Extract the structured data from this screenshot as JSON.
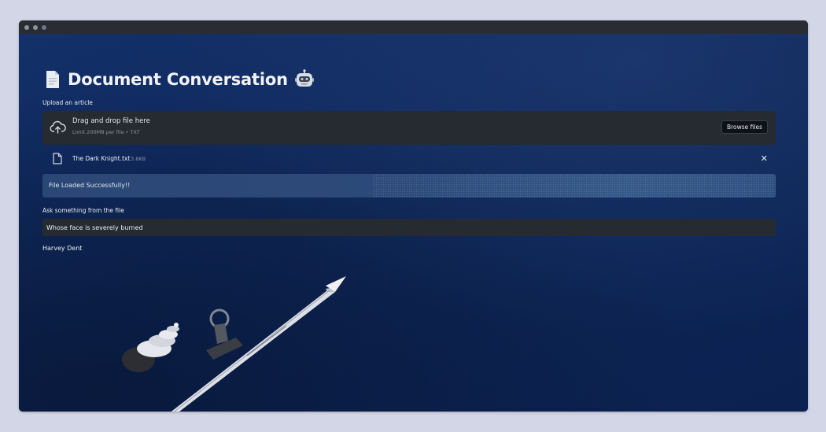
{
  "app": {
    "title": "Document Conversation",
    "title_icon_left": "document-icon",
    "title_icon_right": "robot-icon"
  },
  "uploader": {
    "label": "Upload an article",
    "drag_text": "Drag and drop file here",
    "limit_text": "Limit 200MB per file • TXT",
    "browse_label": "Browse files",
    "icon": "cloud-upload-icon"
  },
  "file": {
    "name": "The Dark Knight.txt",
    "size": "3.8KB",
    "icon": "file-icon",
    "remove_icon": "close-icon"
  },
  "status": {
    "message": "File Loaded Successfully!!"
  },
  "query": {
    "label": "Ask something from the file",
    "value": "Whose face is severely burned"
  },
  "answer": {
    "text": "Harvey Dent"
  },
  "colors": {
    "background": "#0d2550",
    "panel": "#262a31",
    "success": "#2c4a79",
    "text": "#eef0f5",
    "muted": "#8d93a0"
  }
}
